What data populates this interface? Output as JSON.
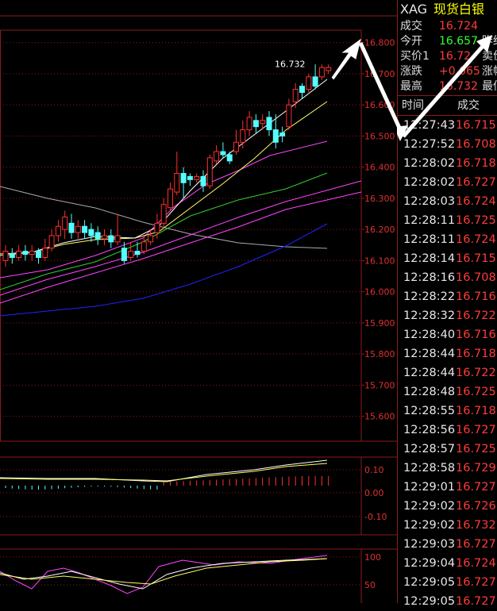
{
  "quote": {
    "code": "XAG",
    "name": "现货白银",
    "rows": [
      {
        "label": "成交",
        "value": "16.724",
        "color": "red",
        "label2": ""
      },
      {
        "label": "今开",
        "value": "16.657",
        "color": "green",
        "label2": "昨结"
      },
      {
        "label": "买价1",
        "value": "16.72",
        "color": "red",
        "label2": "卖价"
      },
      {
        "label": "涨跌",
        "value": "+0.065",
        "color": "red",
        "label2": "涨幅"
      },
      {
        "label": "最高",
        "value": "16.732",
        "color": "red",
        "label2": "最低"
      }
    ],
    "ticks_header": {
      "time": "时间",
      "volume": "成交"
    },
    "ticks": [
      {
        "time": "12:27:43",
        "price": "16.715"
      },
      {
        "time": "12:27:52",
        "price": "16.708"
      },
      {
        "time": "12:28:02",
        "price": "16.718"
      },
      {
        "time": "12:28:02",
        "price": "16.727"
      },
      {
        "time": "12:28:03",
        "price": "16.724"
      },
      {
        "time": "12:28:11",
        "price": "16.725"
      },
      {
        "time": "12:28:11",
        "price": "16.724"
      },
      {
        "time": "12:28:14",
        "price": "16.715"
      },
      {
        "time": "12:28:16",
        "price": "16.708"
      },
      {
        "time": "12:28:22",
        "price": "16.716"
      },
      {
        "time": "12:28:32",
        "price": "16.722"
      },
      {
        "time": "12:28:40",
        "price": "16.716"
      },
      {
        "time": "12:28:44",
        "price": "16.718"
      },
      {
        "time": "12:28:44",
        "price": "16.722"
      },
      {
        "time": "12:28:48",
        "price": "16.725"
      },
      {
        "time": "12:28:55",
        "price": "16.718"
      },
      {
        "time": "12:28:56",
        "price": "16.727"
      },
      {
        "time": "12:28:57",
        "price": "16.725"
      },
      {
        "time": "12:28:58",
        "price": "16.729"
      },
      {
        "time": "12:29:01",
        "price": "16.727"
      },
      {
        "time": "12:29:02",
        "price": "16.726"
      },
      {
        "time": "12:29:02",
        "price": "16.732"
      },
      {
        "time": "12:29:03",
        "price": "16.727"
      },
      {
        "time": "12:29:04",
        "price": "16.724"
      },
      {
        "time": "12:29:05",
        "price": "16.727"
      },
      {
        "time": "12:29:05",
        "price": "16.727"
      }
    ]
  },
  "chart_data": [
    {
      "type": "candlestick",
      "ylim": [
        15.52,
        16.84
      ],
      "y_ticks": [
        "16.800",
        "16.700",
        "16.600",
        "16.500",
        "16.400",
        "16.300",
        "16.200",
        "16.100",
        "16.000",
        "15.900",
        "15.800",
        "15.700",
        "15.600"
      ],
      "y_tick_values": [
        16.8,
        16.7,
        16.6,
        16.5,
        16.4,
        16.3,
        16.2,
        16.1,
        16.0,
        15.9,
        15.8,
        15.7,
        15.6
      ],
      "high_label": "16.732",
      "candles": [
        [
          16.1,
          16.13,
          16.08,
          16.15
        ],
        [
          16.12,
          16.11,
          16.09,
          16.14
        ],
        [
          16.11,
          16.13,
          16.1,
          16.15
        ],
        [
          16.13,
          16.12,
          16.1,
          16.15
        ],
        [
          16.12,
          16.13,
          16.1,
          16.15
        ],
        [
          16.13,
          16.11,
          16.09,
          16.14
        ],
        [
          16.11,
          16.14,
          16.1,
          16.17
        ],
        [
          16.14,
          16.18,
          16.13,
          16.2
        ],
        [
          16.18,
          16.21,
          16.16,
          16.23
        ],
        [
          16.2,
          16.24,
          16.17,
          16.26
        ],
        [
          16.22,
          16.19,
          16.17,
          16.25
        ],
        [
          16.19,
          16.21,
          16.17,
          16.23
        ],
        [
          16.21,
          16.19,
          16.17,
          16.23
        ],
        [
          16.2,
          16.18,
          16.16,
          16.22
        ],
        [
          16.19,
          16.17,
          16.15,
          16.21
        ],
        [
          16.17,
          16.18,
          16.15,
          16.2
        ],
        [
          16.18,
          16.16,
          16.14,
          16.2
        ],
        [
          16.16,
          16.18,
          16.15,
          16.25
        ],
        [
          16.14,
          16.1,
          16.09,
          16.16
        ],
        [
          16.11,
          16.13,
          16.1,
          16.16
        ],
        [
          16.13,
          16.12,
          16.11,
          16.16
        ],
        [
          16.13,
          16.16,
          16.12,
          16.18
        ],
        [
          16.16,
          16.18,
          16.15,
          16.2
        ],
        [
          16.19,
          16.22,
          16.17,
          16.25
        ],
        [
          16.22,
          16.28,
          16.2,
          16.3
        ],
        [
          16.27,
          16.33,
          16.26,
          16.35
        ],
        [
          16.32,
          16.38,
          16.31,
          16.45
        ],
        [
          16.38,
          16.35,
          16.3,
          16.4
        ],
        [
          16.37,
          16.36,
          16.34,
          16.38
        ],
        [
          16.36,
          16.37,
          16.35,
          16.38
        ],
        [
          16.37,
          16.34,
          16.32,
          16.39
        ],
        [
          16.34,
          16.43,
          16.33,
          16.44
        ],
        [
          16.42,
          16.45,
          16.41,
          16.47
        ],
        [
          16.45,
          16.44,
          16.43,
          16.48
        ],
        [
          16.44,
          16.42,
          16.41,
          16.45
        ],
        [
          16.45,
          16.48,
          16.44,
          16.52
        ],
        [
          16.48,
          16.52,
          16.46,
          16.55
        ],
        [
          16.52,
          16.56,
          16.5,
          16.58
        ],
        [
          16.55,
          16.53,
          16.51,
          16.57
        ],
        [
          16.54,
          16.55,
          16.52,
          16.57
        ],
        [
          16.56,
          16.52,
          16.5,
          16.58
        ],
        [
          16.52,
          16.48,
          16.46,
          16.57
        ],
        [
          16.51,
          16.5,
          16.48,
          16.53
        ],
        [
          16.53,
          16.6,
          16.52,
          16.62
        ],
        [
          16.61,
          16.65,
          16.59,
          16.67
        ],
        [
          16.66,
          16.64,
          16.62,
          16.67
        ],
        [
          16.65,
          16.69,
          16.64,
          16.7
        ],
        [
          16.69,
          16.66,
          16.65,
          16.73
        ],
        [
          16.69,
          16.72,
          16.68,
          16.73
        ],
        [
          16.71,
          16.72,
          16.7,
          16.73
        ]
      ]
    },
    {
      "type": "line",
      "y_ticks": [
        "0.10",
        "0.00",
        "-0.10"
      ],
      "y_tick_values": [
        0.1,
        0.0,
        -0.1
      ]
    },
    {
      "type": "line",
      "y_ticks": [
        "100",
        "50"
      ],
      "y_tick_values": [
        100,
        50
      ]
    }
  ]
}
